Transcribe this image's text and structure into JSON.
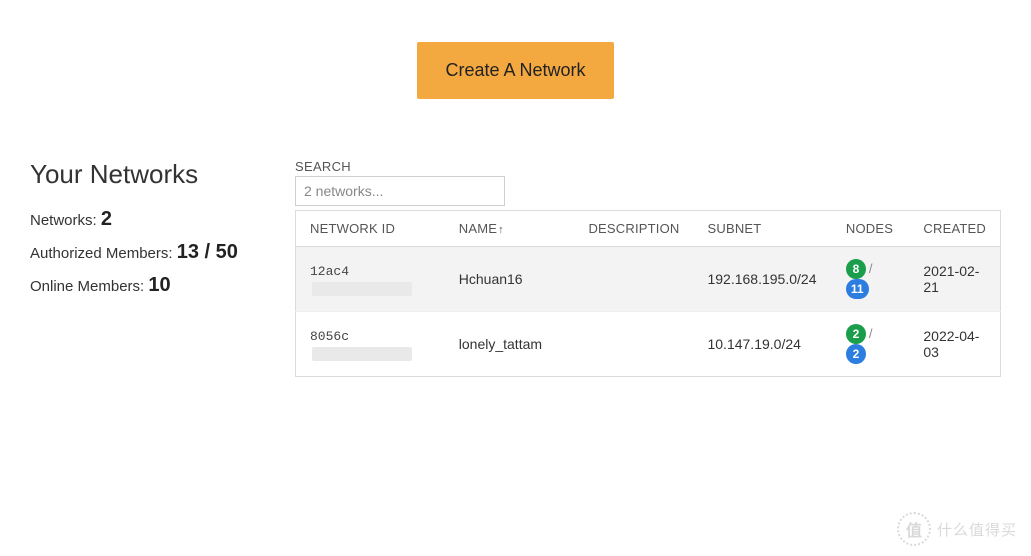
{
  "header": {
    "create_label": "Create A Network"
  },
  "sidebar": {
    "title": "Your Networks",
    "networks_label": "Networks:",
    "networks_value": "2",
    "authorized_label": "Authorized Members:",
    "authorized_value": "13 / 50",
    "online_label": "Online Members:",
    "online_value": "10"
  },
  "search": {
    "label": "SEARCH",
    "placeholder": "2 networks..."
  },
  "table": {
    "headers": {
      "network_id": "NETWORK ID",
      "name": "NAME",
      "sort_indicator": "↑",
      "description": "DESCRIPTION",
      "subnet": "SUBNET",
      "nodes": "NODES",
      "created": "CREATED"
    },
    "rows": [
      {
        "network_id_prefix": "12ac4",
        "name": "Hchuan16",
        "description": "",
        "subnet": "192.168.195.0/24",
        "nodes_online": "8",
        "nodes_total": "11",
        "created": "2021-02-21"
      },
      {
        "network_id_prefix": "8056c",
        "name": "lonely_tattam",
        "description": "",
        "subnet": "10.147.19.0/24",
        "nodes_online": "2",
        "nodes_total": "2",
        "created": "2022-04-03"
      }
    ]
  },
  "watermark": {
    "symbol": "值",
    "text": "什么值得买"
  }
}
